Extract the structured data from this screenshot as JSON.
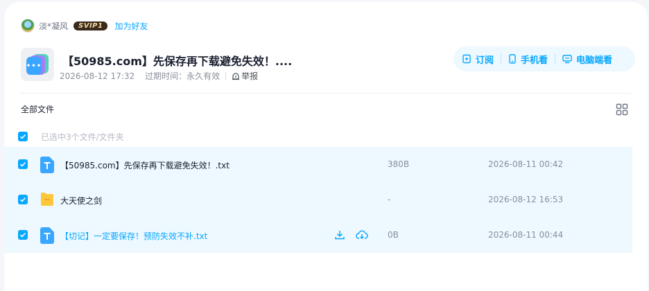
{
  "sharer": {
    "nickname": "淡*凝风",
    "vip_badge": "SVIP1",
    "add_friend": "加为好友"
  },
  "share": {
    "title": "【50985.com】先保存再下载避免失效！....",
    "created_time": "2026-08-12 17:32",
    "expire_label": "过期时间：",
    "expire_value": "永久有效",
    "report": "举报",
    "thumb_text": "•••"
  },
  "actions": {
    "subscribe": "订阅",
    "mobile_view": "手机看",
    "pc_view": "电脑端看"
  },
  "list": {
    "title": "全部文件",
    "selection_text": "已选中3个文件/文件夹",
    "rows": [
      {
        "name": "【50985.com】先保存再下载避免失效！.txt",
        "size": "380B",
        "time": "2026-08-11 00:42",
        "type": "txt",
        "checked": true,
        "icon": "txt-file-icon"
      },
      {
        "name": "大天使之剑",
        "size": "-",
        "time": "2026-08-12 16:53",
        "type": "folder",
        "checked": true,
        "icon": "folder-icon"
      },
      {
        "name": "【切记】一定要保存！预防失效不补.txt",
        "size": "0B",
        "time": "2026-08-11 00:44",
        "type": "txt",
        "checked": true,
        "hovered": true,
        "icon": "txt-file-icon"
      }
    ]
  },
  "colors": {
    "accent": "#06a7ff",
    "row_selected_bg": "#eef8ff",
    "folder": "#fcc73a"
  }
}
